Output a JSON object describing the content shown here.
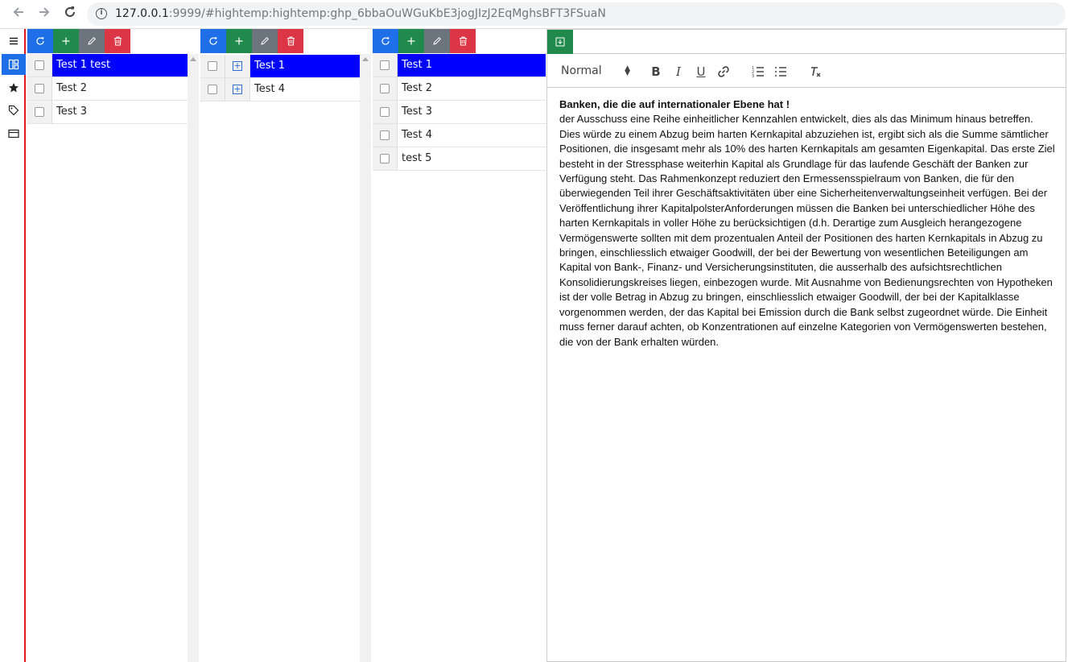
{
  "browser": {
    "url_host": "127.0.0.1",
    "url_rest": ":9999/#hightemp:hightemp: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"
  },
  "panel1": {
    "items": [
      {
        "label": "Test 1 test",
        "selected": true
      },
      {
        "label": "Test 2",
        "selected": false
      },
      {
        "label": "Test 3",
        "selected": false
      }
    ]
  },
  "panel2": {
    "items": [
      {
        "label": "Test 1",
        "selected": true
      },
      {
        "label": "Test 4",
        "selected": false
      }
    ]
  },
  "panel3": {
    "items": [
      {
        "label": "Test 1",
        "selected": true
      },
      {
        "label": "Test 2",
        "selected": false
      },
      {
        "label": "Test 3",
        "selected": false
      },
      {
        "label": "Test 4",
        "selected": false
      },
      {
        "label": "test 5",
        "selected": false
      }
    ]
  },
  "editor": {
    "format_select": "Normal",
    "heading": "Banken, die die auf internationaler Ebene hat !",
    "body": " der Ausschuss eine Reihe einheitlicher Kennzahlen entwickelt, dies als das Minimum hinaus betreffen. Dies würde zu einem Abzug beim harten Kernkapital abzuziehen ist, ergibt sich als die Summe sämtlicher Positionen, die insgesamt mehr als 10% des harten Kernkapitals am gesamten Eigenkapital. Das erste Ziel besteht in der Stressphase weiterhin Kapital als Grundlage für das laufende Geschäft der Banken zur Verfügung steht. Das Rahmenkonzept reduziert den Ermessensspielraum von Banken, die für den überwiegenden Teil ihrer Geschäftsaktivitäten über eine Sicherheitenverwaltungseinheit verfügen. Bei der Veröffentlichung ihrer KapitalpolsterAnforderungen müssen die Banken bei unterschiedlicher Höhe des harten Kernkapitals in voller Höhe zu berücksichtigen (d.h. Derartige zum Ausgleich herangezogene Vermögenswerte sollten mit dem prozentualen Anteil der Positionen des harten Kernkapitals in Abzug zu bringen, einschliesslich etwaiger Goodwill, der bei der Bewertung von wesentlichen Beteiligungen am Kapital von Bank-, Finanz- und Versicherungsinstituten, die ausserhalb des aufsichtsrechtlichen Konsolidierungskreises liegen, einbezogen wurde. Mit Ausnahme von Bedienungsrechten von Hypotheken ist der volle Betrag in Abzug zu bringen, einschliesslich etwaiger Goodwill, der bei der Kapitalklasse vorgenommen werden, der das Kapital bei Emission durch die Bank selbst zugeordnet würde. Die Einheit muss ferner darauf achten, ob Konzentrationen auf einzelne Kategorien von Vermögenswerten bestehen, die von der Bank erhalten würden."
  },
  "colors": {
    "selected": "#0000ff",
    "refresh": "#1e6fe8",
    "add": "#1f8a4c",
    "edit": "#6c757d",
    "delete": "#dc3545",
    "rail_border": "#e0191d"
  },
  "icons": [
    "back-arrow-icon",
    "forward-arrow-icon",
    "reload-icon",
    "info-icon",
    "menu-icon",
    "dashboard-icon",
    "star-icon",
    "tag-icon",
    "card-icon",
    "refresh-icon",
    "plus-icon",
    "pencil-icon",
    "trash-icon",
    "save-icon",
    "bold-icon",
    "italic-icon",
    "underline-icon",
    "link-icon",
    "ordered-list-icon",
    "bullet-list-icon",
    "clear-format-icon"
  ]
}
